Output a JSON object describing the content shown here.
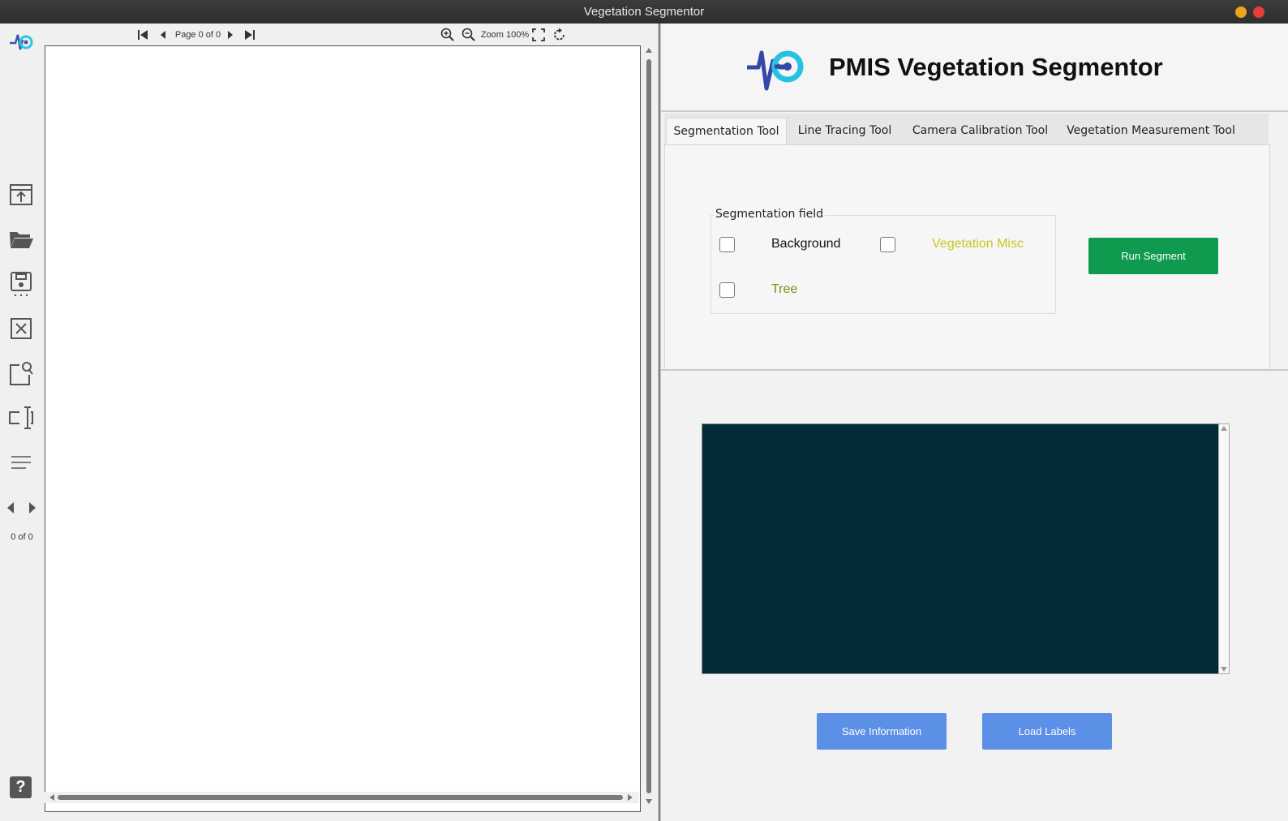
{
  "window": {
    "title": "Vegetation Segmentor"
  },
  "viewer": {
    "page_label": "Page 0 of 0",
    "zoom_label": "Zoom 100%"
  },
  "sidebar": {
    "page_counter": "0 of 0"
  },
  "app": {
    "title": "PMIS Vegetation Segmentor"
  },
  "tabs": [
    {
      "label": "Segmentation Tool",
      "active": true
    },
    {
      "label": "Line Tracing Tool"
    },
    {
      "label": "Camera Calibration Tool"
    },
    {
      "label": "Vegetation Measurement Tool"
    }
  ],
  "segmentation": {
    "legend": "Segmentation field",
    "options": [
      {
        "label": "Background",
        "color": "#111111"
      },
      {
        "label": "Vegetation Misc",
        "color": "#c8c61e"
      },
      {
        "label": "Tree",
        "color": "#8a8a15"
      }
    ],
    "run_label": "Run Segment"
  },
  "actions": {
    "save_label": "Save Information",
    "load_label": "Load Labels"
  },
  "colors": {
    "run_button": "#0f9a4f",
    "action_buttons": "#5c8fe6",
    "output_area": "#022b38"
  }
}
